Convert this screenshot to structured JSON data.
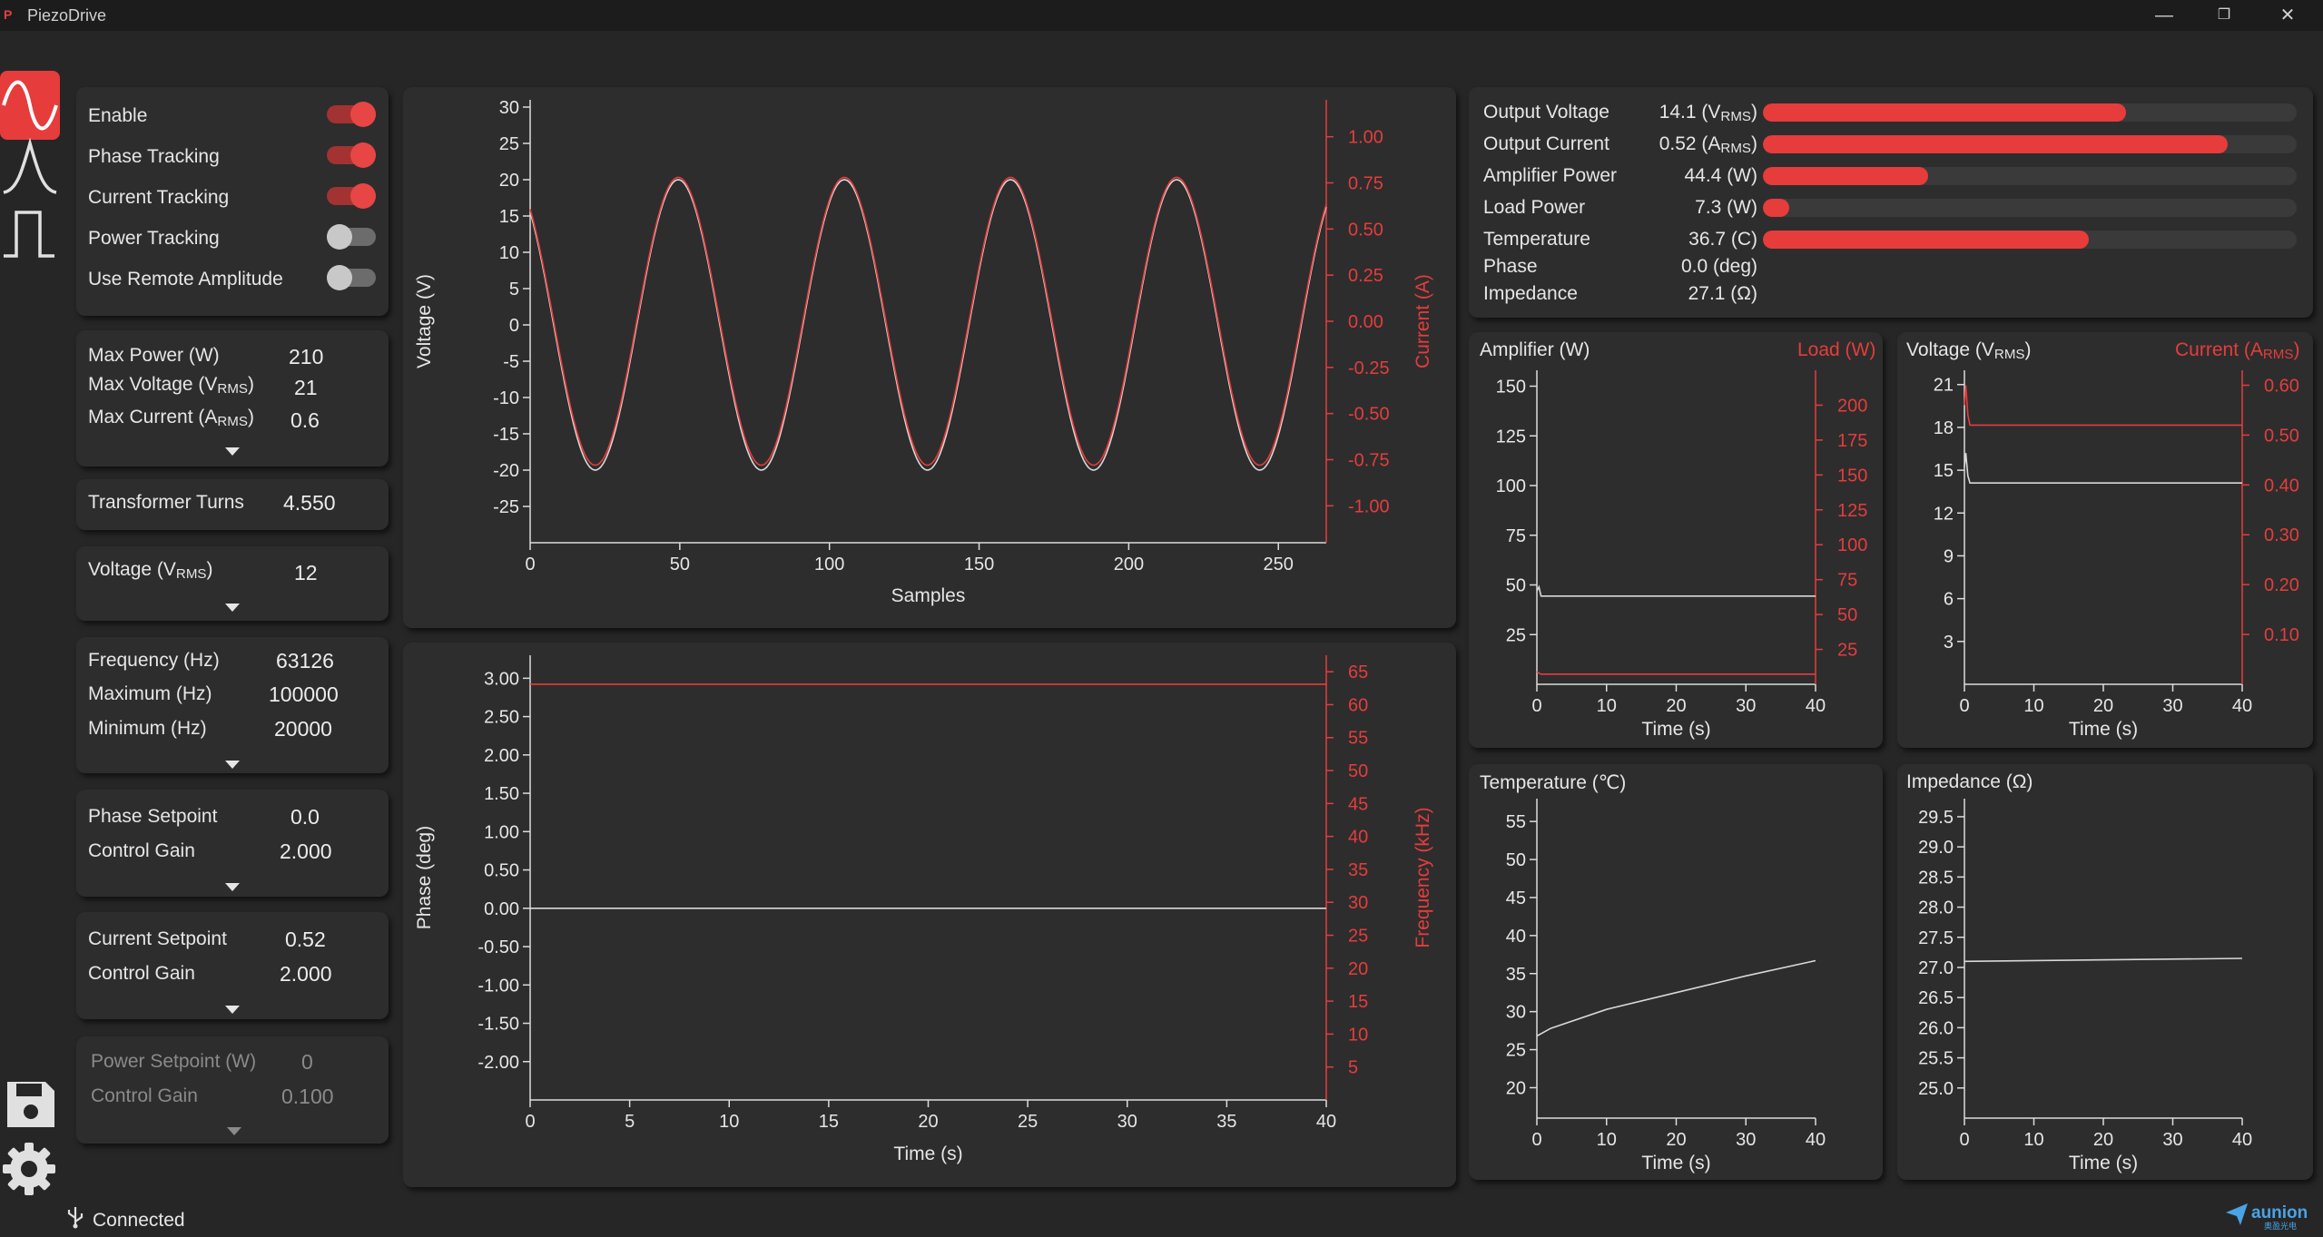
{
  "app": {
    "logo": "P",
    "title": "PiezoDrive"
  },
  "window_controls": {
    "minimize": "—",
    "restore": "❐",
    "close": "✕"
  },
  "rail": {
    "icons": [
      "sine-wave-icon",
      "peak-icon",
      "pulse-icon",
      "save-icon",
      "gear-icon"
    ]
  },
  "toggles": [
    {
      "label": "Enable",
      "on": true
    },
    {
      "label": "Phase Tracking",
      "on": true
    },
    {
      "label": "Current Tracking",
      "on": true
    },
    {
      "label": "Power Tracking",
      "on": false
    },
    {
      "label": "Use Remote Amplitude",
      "on": false
    }
  ],
  "limits": {
    "max_power_label": "Max Power (W)",
    "max_power": "210",
    "max_voltage_label": "Max Voltage (V",
    "max_voltage_sub": "RMS",
    "max_voltage": "21",
    "max_current_label": "Max Current (A",
    "max_current_sub": "RMS",
    "max_current": "0.6"
  },
  "transformer": {
    "label": "Transformer Turns",
    "value": "4.550"
  },
  "voltage": {
    "label": "Voltage (V",
    "sub": "RMS",
    "value": "12"
  },
  "frequency": {
    "freq_label": "Frequency (Hz)",
    "freq": "63126",
    "max_label": "Maximum (Hz)",
    "max": "100000",
    "min_label": "Minimum (Hz)",
    "min": "20000"
  },
  "phase_ctrl": {
    "setpoint_label": "Phase Setpoint",
    "setpoint": "0.0",
    "gain_label": "Control Gain",
    "gain": "2.000"
  },
  "current_ctrl": {
    "setpoint_label": "Current Setpoint",
    "setpoint": "0.52",
    "gain_label": "Control Gain",
    "gain": "2.000"
  },
  "power_ctrl": {
    "setpoint_label": "Power Setpoint (W)",
    "setpoint": "0",
    "gain_label": "Control Gain",
    "gain": "0.100"
  },
  "metrics": [
    {
      "label": "Output Voltage",
      "value": "14.1 (V",
      "sub": "RMS",
      "tail": ")",
      "level": 0.68
    },
    {
      "label": "Output Current",
      "value": "0.52 (A",
      "sub": "RMS",
      "tail": ")",
      "level": 0.87
    },
    {
      "label": "Amplifier Power",
      "value": "44.4 (W)",
      "sub": "",
      "tail": "",
      "level": 0.31
    },
    {
      "label": "Load Power",
      "value": "7.3 (W)",
      "sub": "",
      "tail": "",
      "level": 0.05
    },
    {
      "label": "Temperature",
      "value": "36.7 (C)",
      "sub": "",
      "tail": "",
      "level": 0.61
    },
    {
      "label": "Phase",
      "value": "0.0 (deg)",
      "sub": "",
      "tail": "",
      "level": null
    },
    {
      "label": "Impedance",
      "value": "27.1 (Ω)",
      "sub": "",
      "tail": "",
      "level": null
    }
  ],
  "chart_titles": {
    "amp": "Amplifier (W)",
    "load": "Load (W)",
    "vrms": "Voltage (V",
    "vrms_sub": "RMS",
    "arms": "Current (A",
    "arms_sub": "RMS",
    "temp": "Temperature (℃)",
    "imp": "Impedance (Ω)"
  },
  "colors": {
    "accent": "#e63c3c",
    "trace_white": "#d8d8d8",
    "panel": "#2d2d2d",
    "background": "#262626"
  },
  "chart_data": [
    {
      "type": "line",
      "id": "waveform",
      "xlabel": "Samples",
      "ylabel": "Voltage (V)",
      "y2label": "Current (A)",
      "xlim": [
        0,
        266
      ],
      "ylim": [
        -30,
        31
      ],
      "y2lim": [
        -1.2,
        1.2
      ],
      "x_ticks": [
        0,
        50,
        100,
        150,
        200,
        250
      ],
      "y_ticks": [
        30,
        25,
        20,
        15,
        10,
        5,
        0,
        -5,
        -10,
        -15,
        -20,
        -25
      ],
      "y2_ticks": [
        1.0,
        0.75,
        0.5,
        0.25,
        0.0,
        -0.25,
        -0.5,
        -0.75,
        -1.0
      ],
      "y2_tick_labels": [
        "1.00",
        "0.75",
        "0.50",
        "0.25",
        "0.00",
        "-0.25",
        "-0.50",
        "-0.75",
        "-1.00"
      ],
      "series": [
        {
          "axis": "y",
          "color": "white",
          "amplitude": 20,
          "period_samples": 55.5,
          "phase_peak_at": 49.5
        },
        {
          "axis": "y2",
          "color": "red",
          "amplitude": 0.78,
          "period_samples": 55.5,
          "phase_peak_at": 49.5
        }
      ]
    },
    {
      "type": "line",
      "id": "phase_frequency",
      "xlabel": "Time (s)",
      "ylabel": "Phase (deg)",
      "y2label": "Frequency (kHz)",
      "xlim": [
        0,
        40
      ],
      "ylim": [
        -2.5,
        3.3
      ],
      "y2lim": [
        0,
        67.5
      ],
      "x_ticks": [
        0,
        5,
        10,
        15,
        20,
        25,
        30,
        35,
        40
      ],
      "y_ticks": [
        3,
        2.5,
        2,
        1.5,
        1,
        0.5,
        0,
        -0.5,
        -1,
        -1.5,
        -2
      ],
      "y_tick_labels": [
        "3.00",
        "2.50",
        "2.00",
        "1.50",
        "1.00",
        "0.50",
        "0.00",
        "-0.50",
        "-1.00",
        "-1.50",
        "-2.00"
      ],
      "y2_ticks": [
        65,
        60,
        55,
        50,
        45,
        40,
        35,
        30,
        25,
        20,
        15,
        10,
        5
      ],
      "series": [
        {
          "axis": "y",
          "color": "white",
          "x": [
            0,
            40
          ],
          "y": [
            0.0,
            0.0
          ]
        },
        {
          "axis": "y2",
          "color": "red",
          "x": [
            0,
            40
          ],
          "y": [
            63.1,
            63.1
          ]
        }
      ]
    },
    {
      "type": "line",
      "id": "power",
      "xlabel": "Time (s)",
      "ylabel": "Amplifier (W)",
      "y2label": "Load (W)",
      "xlim": [
        0,
        40
      ],
      "ylim": [
        0,
        158
      ],
      "y2lim": [
        0,
        225
      ],
      "x_ticks": [
        0,
        10,
        20,
        30,
        40
      ],
      "y_ticks": [
        150,
        125,
        100,
        75,
        50,
        25
      ],
      "y2_ticks": [
        200,
        175,
        150,
        125,
        100,
        75,
        50,
        25
      ],
      "series": [
        {
          "axis": "y",
          "color": "white",
          "x": [
            0,
            0.3,
            0.6,
            40
          ],
          "y": [
            47,
            49,
            44.4,
            44.4
          ]
        },
        {
          "axis": "y2",
          "color": "red",
          "x": [
            0,
            0.3,
            0.6,
            40
          ],
          "y": [
            9,
            8,
            7.3,
            7.3
          ]
        }
      ]
    },
    {
      "type": "line",
      "id": "voltage_current",
      "xlabel": "Time (s)",
      "ylabel": "Voltage (VRMS)",
      "y2label": "Current (ARMS)",
      "xlim": [
        0,
        40
      ],
      "ylim": [
        0,
        22
      ],
      "y2lim": [
        0,
        0.63
      ],
      "x_ticks": [
        0,
        10,
        20,
        30,
        40
      ],
      "y_ticks": [
        21,
        18,
        15,
        12,
        9,
        6,
        3
      ],
      "y2_ticks": [
        0.6,
        0.5,
        0.4,
        0.3,
        0.2,
        0.1
      ],
      "y2_tick_labels": [
        "0.60",
        "0.50",
        "0.40",
        "0.30",
        "0.20",
        "0.10"
      ],
      "series": [
        {
          "axis": "y",
          "color": "white",
          "x": [
            0,
            0.2,
            0.5,
            0.8,
            40
          ],
          "y": [
            15.2,
            16.2,
            14.6,
            14.1,
            14.1
          ]
        },
        {
          "axis": "y2",
          "color": "red",
          "x": [
            0,
            0.2,
            0.5,
            0.8,
            40
          ],
          "y": [
            0.56,
            0.6,
            0.54,
            0.52,
            0.52
          ]
        }
      ]
    },
    {
      "type": "line",
      "id": "temperature",
      "xlabel": "Time (s)",
      "ylabel": "Temperature (℃)",
      "xlim": [
        0,
        40
      ],
      "ylim": [
        16,
        58
      ],
      "x_ticks": [
        0,
        10,
        20,
        30,
        40
      ],
      "y_ticks": [
        55,
        50,
        45,
        40,
        35,
        30,
        25,
        20
      ],
      "series": [
        {
          "axis": "y",
          "color": "white",
          "x": [
            0,
            2,
            10,
            20,
            30,
            40
          ],
          "y": [
            26.8,
            27.8,
            30.3,
            32.5,
            34.7,
            36.7
          ]
        }
      ]
    },
    {
      "type": "line",
      "id": "impedance",
      "xlabel": "Time (s)",
      "ylabel": "Impedance (Ω)",
      "xlim": [
        0,
        40
      ],
      "ylim": [
        24.5,
        29.8
      ],
      "x_ticks": [
        0,
        10,
        20,
        30,
        40
      ],
      "y_ticks": [
        29.5,
        29,
        28.5,
        28,
        27.5,
        27,
        26.5,
        26,
        25.5,
        25
      ],
      "y_tick_labels": [
        "29.5",
        "29.0",
        "28.5",
        "28.0",
        "27.5",
        "27.0",
        "26.5",
        "26.0",
        "25.5",
        "25.0"
      ],
      "series": [
        {
          "axis": "y",
          "color": "white",
          "x": [
            0,
            40
          ],
          "y": [
            27.1,
            27.15
          ]
        }
      ]
    }
  ],
  "status": {
    "text": "Connected"
  },
  "brand": {
    "name": "aunion",
    "sub": "奥盈光电"
  }
}
